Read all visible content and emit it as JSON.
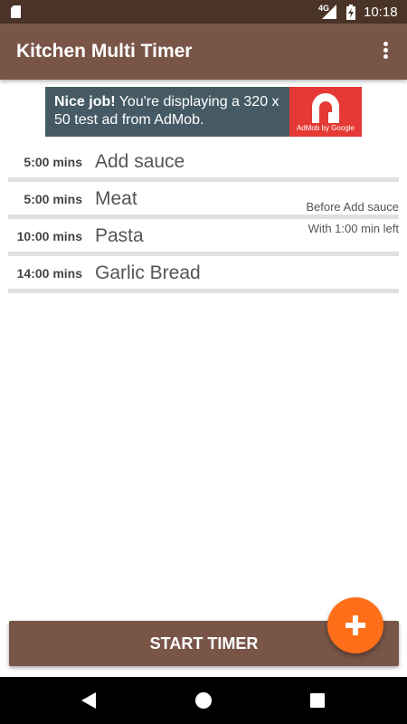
{
  "status_bar": {
    "time": "10:18",
    "network": "4G",
    "icons": [
      "sd-card-icon",
      "signal-icon",
      "battery-charging-icon"
    ]
  },
  "app_bar": {
    "title": "Kitchen Multi Timer",
    "menu_icon": "overflow-menu-icon"
  },
  "ad": {
    "headline": "Nice job!",
    "body": " You're displaying a 320 x 50 test ad from AdMob.",
    "brand_caption": "AdMob by Google"
  },
  "timers": [
    {
      "duration": "5:00 mins",
      "name": "Add sauce"
    },
    {
      "duration": "5:00 mins",
      "name": "Meat"
    },
    {
      "duration": "10:00 mins",
      "name": "Pasta"
    },
    {
      "duration": "14:00 mins",
      "name": "Garlic Bread"
    }
  ],
  "note": {
    "line1": "Before Add sauce",
    "line2": "With 1:00 min left"
  },
  "start_button": {
    "label": "START TIMER"
  },
  "fab": {
    "icon": "plus-icon"
  },
  "nav_bar": {
    "icons": [
      "back-icon",
      "home-icon",
      "recents-icon"
    ]
  },
  "colors": {
    "status_bar": "#4a3428",
    "primary": "#795548",
    "accent": "#ff6f1a",
    "ad_background": "#455a64",
    "ad_logo": "#e53935"
  }
}
